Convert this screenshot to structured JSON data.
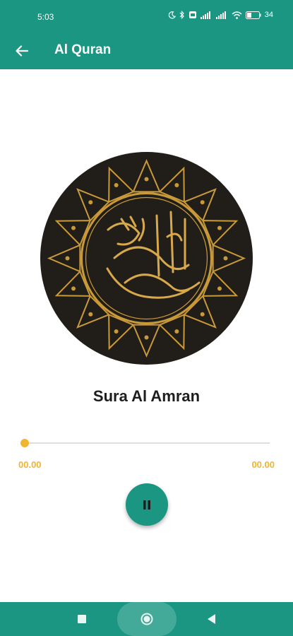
{
  "status_bar": {
    "time": "5:03",
    "battery": "34"
  },
  "app_bar": {
    "title": "Al Quran",
    "back_icon": "arrow-back-icon"
  },
  "player": {
    "artwork": "quran-calligraphy-emblem",
    "track_title": "Sura Al Amran",
    "elapsed": "00.00",
    "duration": "00.00",
    "progress": 0,
    "play_button_icon": "pause-icon"
  },
  "nav_bar": {
    "icons": [
      "recents-square-icon",
      "home-circle-icon",
      "back-triangle-icon"
    ]
  },
  "colors": {
    "primary": "#1a9682",
    "accent": "#f0b532",
    "artwork_bg": "#211d18",
    "gold": "#c99a3a"
  }
}
